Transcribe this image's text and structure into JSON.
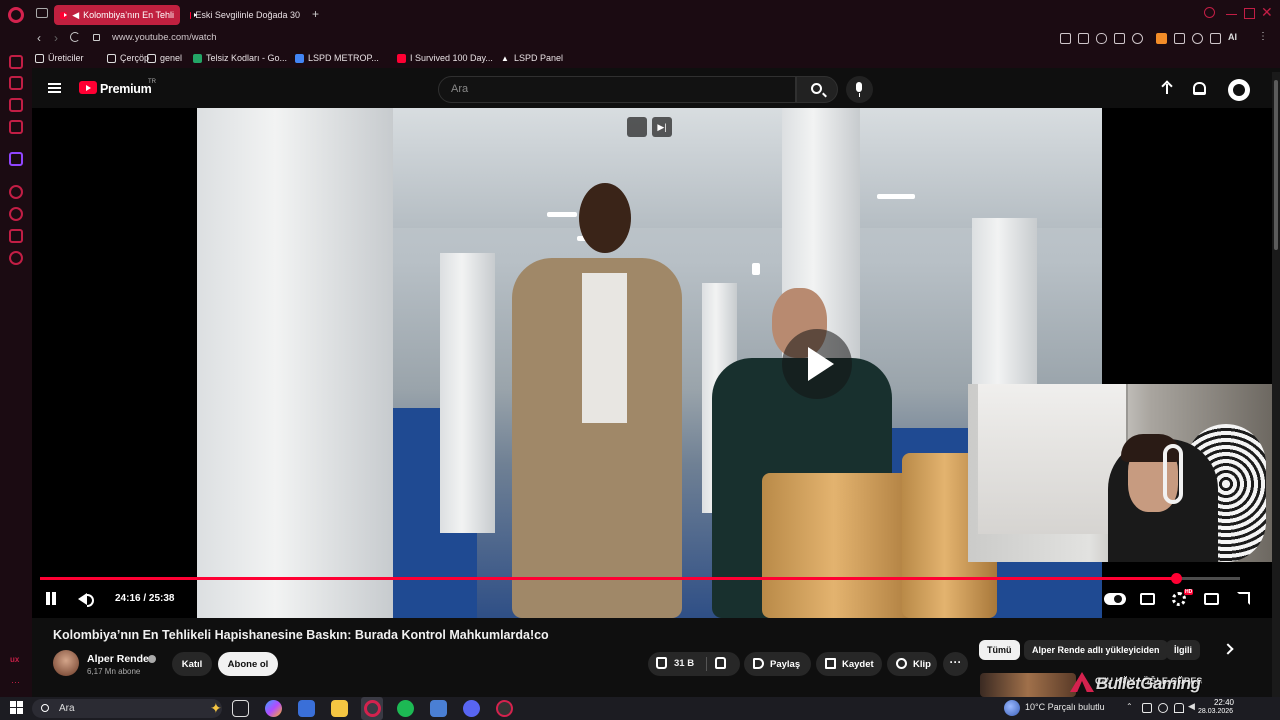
{
  "browser": {
    "tabs": [
      {
        "label": "Kolombiya’nın En Tehli",
        "active": true
      },
      {
        "label": "Eski Sevgilinle Doğada 30",
        "active": false
      }
    ],
    "new_tab_label": "+",
    "url": "www.youtube.com/watch",
    "ai_label": "AI",
    "bookmarks": [
      {
        "label": "Üreticiler",
        "icon": "folder-icon"
      },
      {
        "label": "Çerçöp",
        "icon": "folder-icon"
      },
      {
        "label": "genel",
        "icon": "folder-icon"
      },
      {
        "label": "Telsiz Kodları - Go...",
        "icon": "sheets-icon"
      },
      {
        "label": "LSPD METROP...",
        "icon": "docs-icon"
      },
      {
        "label": "I Survived 100 Day...",
        "icon": "youtube-icon"
      },
      {
        "label": "LSPD Panel",
        "icon": "triangle-icon"
      }
    ],
    "sidebar_footer": "ux",
    "accent": "#c0203f"
  },
  "youtube": {
    "brand": "Premium",
    "country": "TR",
    "search_placeholder": "Ara",
    "player": {
      "current_time": "24:16",
      "separator": " / ",
      "duration": "25:38",
      "progress_fraction": 0.9467,
      "hd_badge": "HD"
    },
    "video": {
      "title": "Kolombiya’nın En Tehlikeli Hapishanesine Baskın: Burada Kontrol Mahkumlarda!co",
      "channel": "Alper Rende",
      "subscribers": "6,17 Mn abone",
      "join_label": "Katıl",
      "subscribe_label": "Abone ol",
      "likes": "31 B",
      "share_label": "Paylaş",
      "save_label": "Kaydet",
      "clip_label": "Klip",
      "more_label": "···"
    },
    "chips": [
      "Tümü",
      "Alper Rende adlı yükleyiciden",
      "İlgili"
    ],
    "rec_title_partial": "C#U KÖY | ÖĞLE GÜREŞ",
    "watermark": "BulletGaming",
    "colors": {
      "red": "#ff0033",
      "bg": "#0f0f0f"
    }
  },
  "taskbar": {
    "search_placeholder": "Ara",
    "weather": "10°C  Parçalı bulutlu",
    "time": "22:40",
    "date": "28.03.2026"
  }
}
